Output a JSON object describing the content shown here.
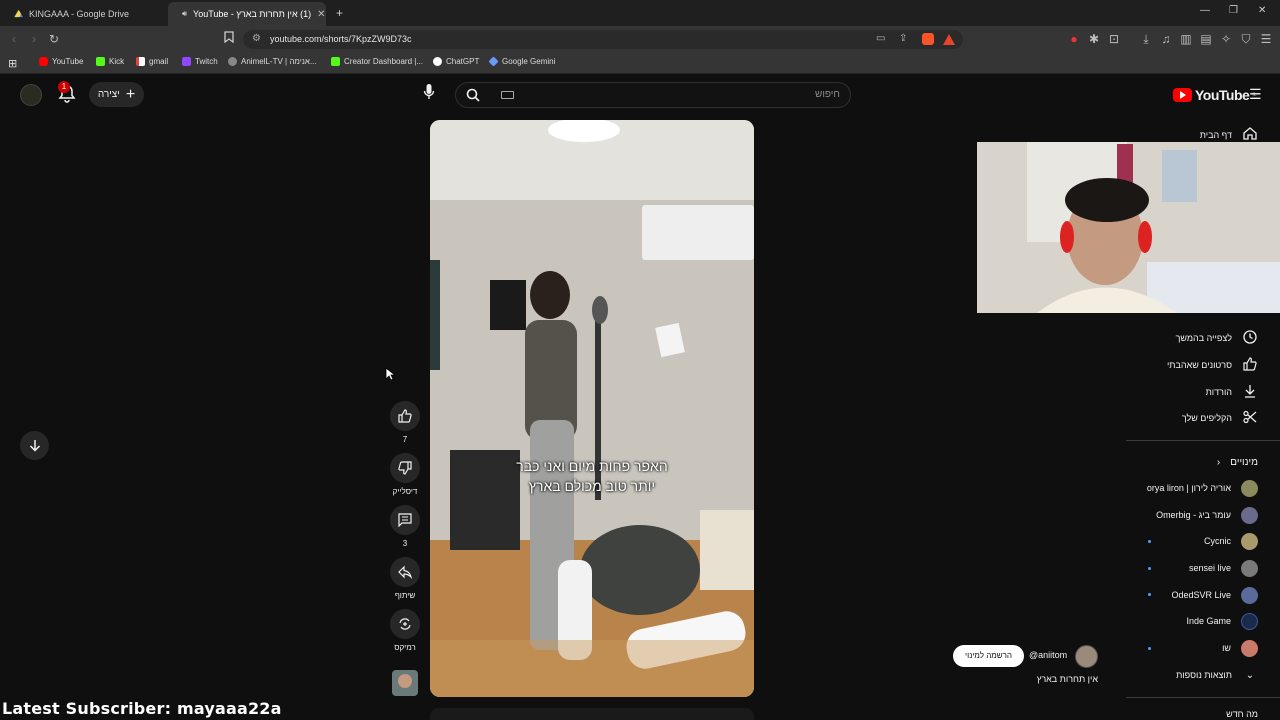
{
  "browser": {
    "tabs": [
      {
        "title": "KINGAAA - Google Drive"
      },
      {
        "title": "(1) אין תחרות בארץ - YouTube"
      }
    ],
    "url": "youtube.com/shorts/7KpzZW9D73c",
    "bookmarks": [
      "YouTube",
      "Kick",
      "gmail",
      "Twitch",
      "AnimelL-TV | אנימה...",
      "Creator Dashboard |...",
      "ChatGPT",
      "Google Gemini"
    ]
  },
  "header": {
    "logo_text": "YouTube",
    "logo_region": "IL",
    "search_placeholder": "חיפוש",
    "create_label": "יצירה",
    "notifications_count": "1"
  },
  "sidebar": {
    "home": "דף הבית",
    "items": [
      {
        "label": "לצפייה בהמשך",
        "icon": "clock-icon"
      },
      {
        "label": "סרטונים שאהבתי",
        "icon": "thumbs-up-icon"
      },
      {
        "label": "הורדות",
        "icon": "download-icon"
      },
      {
        "label": "הקליפים שלך",
        "icon": "scissors-icon"
      }
    ],
    "subscriptions_title": "מינויים",
    "subscriptions": [
      {
        "name": "אוריה לירון | orya liron",
        "color": "#8a8a5c",
        "live": false
      },
      {
        "name": "עומר ביג - Omerbig",
        "color": "#6a6a8a",
        "live": false
      },
      {
        "name": "Cycnic",
        "color": "#a89a6a",
        "live": true
      },
      {
        "name": "sensei live",
        "color": "#7a7a7a",
        "live": true
      },
      {
        "name": "OdedSVR Live",
        "color": "#5a6a9a",
        "live": true
      },
      {
        "name": "Inde Game",
        "color": "#1b2a4a",
        "live": false
      },
      {
        "name": "שו",
        "color": "#c97a6a",
        "live": true
      }
    ],
    "more_results": "תוצאות נוספות",
    "bottom_label": "מה חדש"
  },
  "actions": {
    "like_count": "7",
    "dislike_label": "דיסלייק",
    "comments_count": "3",
    "share_label": "שיתוף",
    "remix_label": "רמיקס"
  },
  "video": {
    "caption_line1": "האפר פחות מיום ואני כבר",
    "caption_line2": "יותר טוב מכולם בארץ",
    "channel_handle": "@aniitom",
    "subscribe_label": "הרשמה למינוי",
    "title": "אין תחרות בארץ"
  },
  "overlay": {
    "latest_subscriber": "Latest Subscriber: mayaaa22a"
  }
}
